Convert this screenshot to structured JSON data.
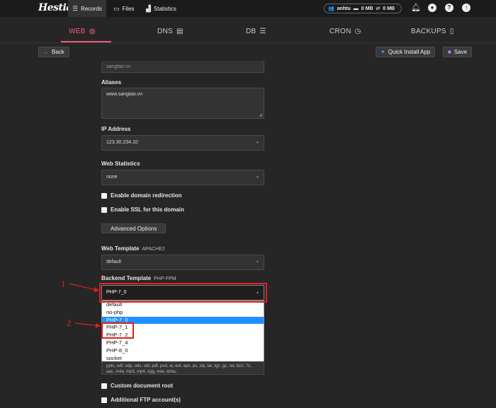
{
  "topbar": {
    "logo": "Hestia",
    "nav": [
      {
        "label": "Records",
        "icon": "list-icon"
      },
      {
        "label": "Files",
        "icon": "folder-icon"
      },
      {
        "label": "Statistics",
        "icon": "chart-icon"
      }
    ],
    "user": {
      "name": "anhtu",
      "disk": "0 MB",
      "bandwidth": "0 MB"
    }
  },
  "tabs": [
    {
      "label": "WEB",
      "icon": "globe-icon"
    },
    {
      "label": "DNS",
      "icon": "book-icon"
    },
    {
      "label": "DB",
      "icon": "database-icon"
    },
    {
      "label": "CRON",
      "icon": "clock-icon"
    },
    {
      "label": "BACKUPS",
      "icon": "file-icon"
    }
  ],
  "toolbar": {
    "back_label": "Back",
    "quick_install_label": "Quick Install App",
    "save_label": "Save"
  },
  "form": {
    "domain_value": "sangtao.vn",
    "aliases_label": "Aliases",
    "aliases_value": "www.sangtao.vn",
    "ip_label": "IP Address",
    "ip_value": "123.30.234.10",
    "stats_label": "Web Statistics",
    "stats_value": "none",
    "redirect_label": "Enable domain redirection",
    "ssl_label": "Enable SSL for this domain",
    "advanced_label": "Advanced Options",
    "web_template_label": "Web Template",
    "web_template_sub": "APACHE2",
    "web_template_value": "default",
    "backend_label": "Backend Template",
    "backend_sub": "PHP-FPM",
    "backend_value": "PHP-7_0",
    "backend_options": [
      "default",
      "no-php",
      "PHP-7_0",
      "PHP-7_1",
      "PHP-7_2",
      "PHP-7_4",
      "PHP-8_0",
      "socket"
    ],
    "backend_selected": "PHP-7_0",
    "extensions_text": "pptx, odf, odp, ods, odt, pdf, psd, ai, eot, eps, ps, zip, tar, tgz, gz, rar, bz2, 7z, aac, m4a, mp3, mp4, ogg, wav, wma,",
    "custom_root_label": "Custom document root",
    "ftp_label": "Additional FTP account(s)"
  },
  "annotations": {
    "marker1": "1",
    "marker2": "2",
    "annotation_color": "#e02020"
  },
  "colors": {
    "accent": "#ef5b7a",
    "selected": "#1e90ff"
  }
}
